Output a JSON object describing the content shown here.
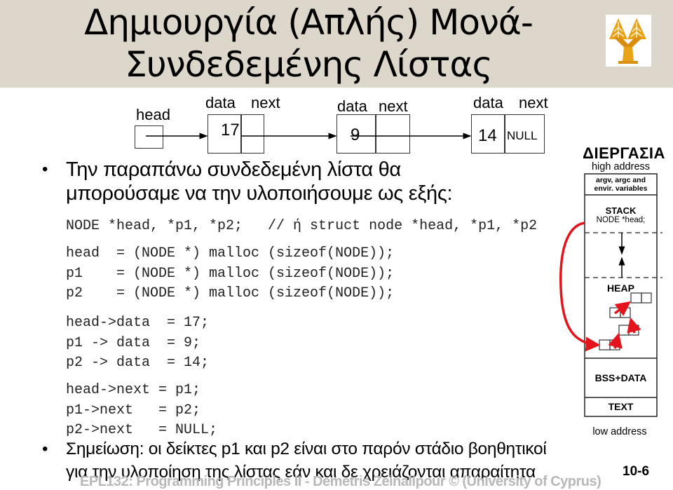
{
  "slide": {
    "title_line1": "Δημιουργία (Απλής) Μονά-",
    "title_line2": "Συνδεδεμένης Λίστας",
    "logo": "university-of-cyprus-tree-logo",
    "slide_number": "10-6",
    "footer": "EPL132: Programming Principles II - Demetris Zeinalipour © (University of Cyprus)"
  },
  "diagram": {
    "head_label": "head",
    "nodes": [
      {
        "data_label": "data",
        "next_label": "next",
        "value": "17",
        "next": ""
      },
      {
        "data_label": "data",
        "next_label": "next",
        "value": "9",
        "next": ""
      },
      {
        "data_label": "data",
        "next_label": "next",
        "value": "14",
        "next": "NULL"
      }
    ]
  },
  "bullets": [
    {
      "line1": "Την παραπάνω συνδεδεμένη λίστα θα",
      "line2": "μπορούσαμε να την υλοποιήσουμε ως εξής:"
    },
    {
      "line1": "Σημείωση: οι δείκτες p1 και p2 είναι στο παρόν στάδιο βοηθητικοί",
      "line2": "για την υλοποίηση της λίστας εάν και δε χρειάζονται απαραίτητα"
    }
  ],
  "code": {
    "declaration": "NODE *head, *p1, *p2;   // ή struct node *head, *p1, *p2",
    "malloc_lines": [
      "head  = (NODE *) malloc (sizeof(NODE));",
      "p1    = (NODE *) malloc (sizeof(NODE));",
      "p2    = (NODE *) malloc (sizeof(NODE));"
    ],
    "data_lines": [
      "head->data  = 17;",
      "p1 -> data  = 9;",
      "p2 -> data  = 14;"
    ],
    "next_lines": [
      "head->next = p1;",
      "p1->next   = p2;",
      "p2->next   = NULL;"
    ]
  },
  "memory": {
    "title": "ΔΙΕΡΓΑΣΙΑ",
    "high_address": "high address",
    "args_line1": "argv, argc and",
    "args_line2": "envir. variables",
    "stack_label": "STACK",
    "stack_content": "NODE  *head;",
    "heap_label": "HEAP",
    "bss_label": "BSS+DATA",
    "text_label": "TEXT",
    "low_address": "low address",
    "arrow_color": "#E3141B"
  },
  "colors": {
    "header_bg": "#DDD6CA",
    "logo_gold": "#E8A317",
    "footer_text": "#B8B8B8"
  }
}
